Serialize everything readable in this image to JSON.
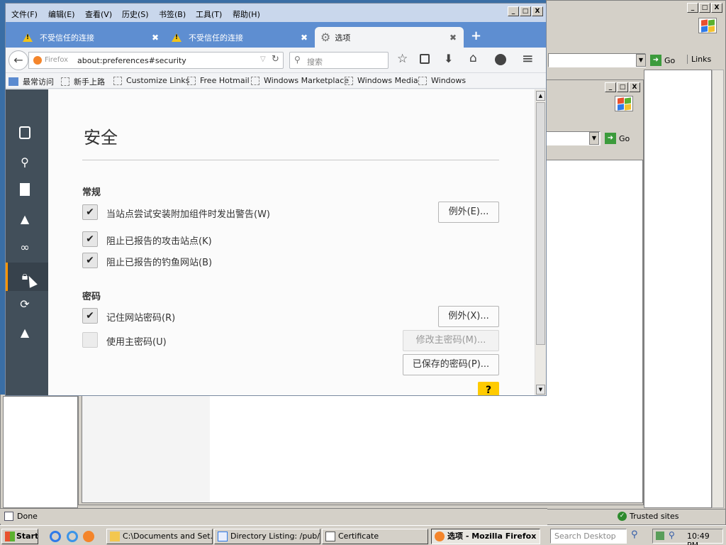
{
  "firefox": {
    "menu": [
      "文件(F)",
      "编辑(E)",
      "查看(V)",
      "历史(S)",
      "书签(B)",
      "工具(T)",
      "帮助(H)"
    ],
    "tabs": [
      {
        "title": "不受信任的连接"
      },
      {
        "title": "不受信任的连接"
      },
      {
        "title": "选项"
      }
    ],
    "identity_label": "Firefox",
    "url": "about:preferences#security",
    "search_placeholder": "搜索",
    "bookmarks": [
      "最常访问",
      "新手上路",
      "Customize Links",
      "Free Hotmail",
      "Windows Marketplace",
      "Windows Media",
      "Windows"
    ],
    "prefs": {
      "title": "安全",
      "general_heading": "常规",
      "warn_addons_label": "当站点尝试安装附加组件时发出警告(W)",
      "addon_exceptions_button": "例外(E)...",
      "block_attack_label": "阻止已报告的攻击站点(K)",
      "block_phishing_label": "阻止已报告的钓鱼网站(B)",
      "passwords_heading": "密码",
      "remember_passwords_label": "记住网站密码(R)",
      "password_exceptions_button": "例外(X)...",
      "master_password_label": "使用主密码(U)",
      "change_master_button": "修改主密码(M)...",
      "saved_passwords_button": "已保存的密码(P)...",
      "help_button": "?",
      "checkboxes": {
        "warn_addons": true,
        "block_attack": true,
        "block_phishing": true,
        "remember_passwords": true,
        "master_password": false
      }
    },
    "controls": {
      "minimize": "_",
      "maximize": "□",
      "close": "X",
      "new_tab": "+",
      "tab_close": "✖",
      "menu_icon": "≡"
    }
  },
  "ie_back": {
    "go_label": "Go",
    "links_label": "Links",
    "status": "Done",
    "zone": "Trusted sites"
  },
  "ie_mid": {
    "go_label": "Go"
  },
  "taskbar": {
    "start": "Start",
    "items": [
      "C:\\Documents and Set...",
      "Directory Listing: /pub/...",
      "Certificate",
      "选项 - Mozilla Firefox"
    ],
    "search_placeholder": "Search Desktop",
    "clock": "10:49 PM"
  }
}
